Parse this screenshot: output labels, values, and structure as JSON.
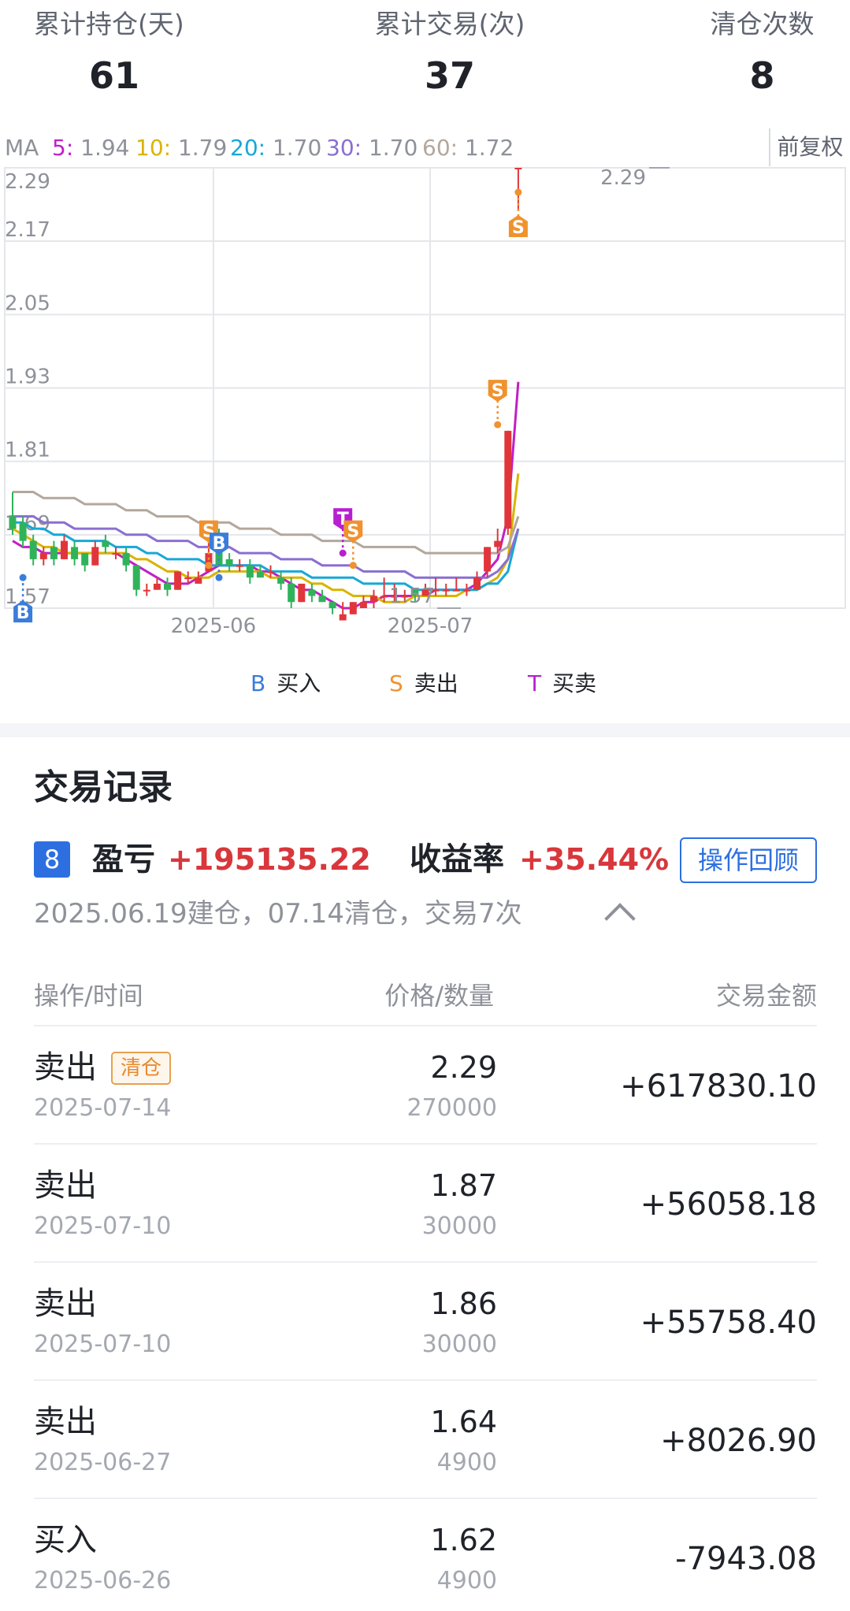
{
  "stats": [
    {
      "label": "累计持仓(天)",
      "value": "61"
    },
    {
      "label": "累计交易(次)",
      "value": "37"
    },
    {
      "label": "清仓次数",
      "value": "8"
    }
  ],
  "ma": {
    "prefix": "MA",
    "items": [
      {
        "key": "5:",
        "value": "1.94",
        "color": "#c21fc6"
      },
      {
        "key": "10:",
        "value": "1.79",
        "color": "#d9b400"
      },
      {
        "key": "20:",
        "value": "1.70",
        "color": "#17a8d6"
      },
      {
        "key": "30:",
        "value": "1.70",
        "color": "#8a6fd0"
      },
      {
        "key": "60:",
        "value": "1.72",
        "color": "#b3a79c"
      }
    ],
    "adjust_label": "前复权"
  },
  "chart_data": {
    "type": "candlestick",
    "y_tick_labels": [
      "2.29",
      "2.17",
      "2.05",
      "1.93",
      "1.81",
      "1.69",
      "1.57"
    ],
    "ylim": [
      1.57,
      2.29
    ],
    "x_tick_labels": [
      "2025-06",
      "2025-07"
    ],
    "max_label": "2.29",
    "min_label": "1.57",
    "up_color": "#e0363b",
    "down_color": "#2fb35a",
    "candles": [
      {
        "o": 1.72,
        "c": 1.7,
        "h": 1.76,
        "l": 1.69
      },
      {
        "o": 1.71,
        "c": 1.68,
        "h": 1.72,
        "l": 1.67
      },
      {
        "o": 1.68,
        "c": 1.65,
        "h": 1.69,
        "l": 1.64
      },
      {
        "o": 1.65,
        "c": 1.66,
        "h": 1.67,
        "l": 1.64
      },
      {
        "o": 1.67,
        "c": 1.65,
        "h": 1.68,
        "l": 1.64
      },
      {
        "o": 1.65,
        "c": 1.68,
        "h": 1.69,
        "l": 1.65
      },
      {
        "o": 1.67,
        "c": 1.65,
        "h": 1.68,
        "l": 1.64
      },
      {
        "o": 1.66,
        "c": 1.64,
        "h": 1.66,
        "l": 1.63
      },
      {
        "o": 1.64,
        "c": 1.67,
        "h": 1.68,
        "l": 1.64
      },
      {
        "o": 1.68,
        "c": 1.67,
        "h": 1.69,
        "l": 1.66
      },
      {
        "o": 1.66,
        "c": 1.66,
        "h": 1.67,
        "l": 1.65
      },
      {
        "o": 1.66,
        "c": 1.64,
        "h": 1.67,
        "l": 1.63
      },
      {
        "o": 1.64,
        "c": 1.6,
        "h": 1.64,
        "l": 1.59
      },
      {
        "o": 1.6,
        "c": 1.6,
        "h": 1.61,
        "l": 1.59
      },
      {
        "o": 1.6,
        "c": 1.61,
        "h": 1.62,
        "l": 1.6
      },
      {
        "o": 1.61,
        "c": 1.6,
        "h": 1.62,
        "l": 1.59
      },
      {
        "o": 1.6,
        "c": 1.63,
        "h": 1.63,
        "l": 1.6
      },
      {
        "o": 1.62,
        "c": 1.62,
        "h": 1.63,
        "l": 1.61
      },
      {
        "o": 1.61,
        "c": 1.62,
        "h": 1.63,
        "l": 1.61
      },
      {
        "o": 1.63,
        "c": 1.66,
        "h": 1.71,
        "l": 1.63
      },
      {
        "o": 1.67,
        "c": 1.64,
        "h": 1.7,
        "l": 1.64
      },
      {
        "o": 1.65,
        "c": 1.64,
        "h": 1.66,
        "l": 1.63
      },
      {
        "o": 1.64,
        "c": 1.64,
        "h": 1.65,
        "l": 1.63
      },
      {
        "o": 1.64,
        "c": 1.62,
        "h": 1.65,
        "l": 1.61
      },
      {
        "o": 1.63,
        "c": 1.62,
        "h": 1.64,
        "l": 1.62
      },
      {
        "o": 1.63,
        "c": 1.63,
        "h": 1.64,
        "l": 1.62
      },
      {
        "o": 1.62,
        "c": 1.61,
        "h": 1.63,
        "l": 1.6
      },
      {
        "o": 1.61,
        "c": 1.58,
        "h": 1.62,
        "l": 1.57
      },
      {
        "o": 1.58,
        "c": 1.61,
        "h": 1.61,
        "l": 1.58
      },
      {
        "o": 1.6,
        "c": 1.59,
        "h": 1.61,
        "l": 1.58
      },
      {
        "o": 1.59,
        "c": 1.58,
        "h": 1.6,
        "l": 1.58
      },
      {
        "o": 1.58,
        "c": 1.57,
        "h": 1.58,
        "l": 1.56
      },
      {
        "o": 1.55,
        "c": 1.56,
        "h": 1.58,
        "l": 1.55
      },
      {
        "o": 1.56,
        "c": 1.58,
        "h": 1.58,
        "l": 1.56
      },
      {
        "o": 1.57,
        "c": 1.58,
        "h": 1.59,
        "l": 1.57
      },
      {
        "o": 1.58,
        "c": 1.59,
        "h": 1.6,
        "l": 1.57
      },
      {
        "o": 1.59,
        "c": 1.59,
        "h": 1.62,
        "l": 1.58
      },
      {
        "o": 1.59,
        "c": 1.59,
        "h": 1.61,
        "l": 1.58
      },
      {
        "o": 1.59,
        "c": 1.59,
        "h": 1.6,
        "l": 1.58
      },
      {
        "o": 1.6,
        "c": 1.59,
        "h": 1.6,
        "l": 1.58
      },
      {
        "o": 1.59,
        "c": 1.6,
        "h": 1.61,
        "l": 1.59
      },
      {
        "o": 1.6,
        "c": 1.6,
        "h": 1.62,
        "l": 1.59
      },
      {
        "o": 1.6,
        "c": 1.6,
        "h": 1.61,
        "l": 1.59
      },
      {
        "o": 1.6,
        "c": 1.6,
        "h": 1.62,
        "l": 1.6
      },
      {
        "o": 1.6,
        "c": 1.6,
        "h": 1.61,
        "l": 1.59
      },
      {
        "o": 1.6,
        "c": 1.62,
        "h": 1.63,
        "l": 1.6
      },
      {
        "o": 1.63,
        "c": 1.67,
        "h": 1.67,
        "l": 1.62
      },
      {
        "o": 1.67,
        "c": 1.68,
        "h": 1.7,
        "l": 1.66
      },
      {
        "o": 1.7,
        "c": 1.86,
        "h": 1.86,
        "l": 1.69
      },
      {
        "o": 2.29,
        "c": 2.29,
        "h": 2.29,
        "l": 2.22
      }
    ],
    "series": [
      {
        "name": "5",
        "color": "#c21fc6",
        "values": [
          1.68,
          1.67,
          1.67,
          1.66,
          1.66,
          1.66,
          1.66,
          1.66,
          1.66,
          1.66,
          1.66,
          1.65,
          1.64,
          1.63,
          1.62,
          1.61,
          1.61,
          1.61,
          1.62,
          1.63,
          1.64,
          1.64,
          1.64,
          1.64,
          1.63,
          1.63,
          1.62,
          1.61,
          1.6,
          1.6,
          1.59,
          1.58,
          1.57,
          1.57,
          1.58,
          1.58,
          1.59,
          1.59,
          1.59,
          1.59,
          1.59,
          1.6,
          1.6,
          1.6,
          1.6,
          1.61,
          1.63,
          1.65,
          1.72,
          1.94
        ]
      },
      {
        "name": "10",
        "color": "#d9b400",
        "values": [
          1.7,
          1.69,
          1.68,
          1.67,
          1.67,
          1.66,
          1.66,
          1.66,
          1.66,
          1.66,
          1.66,
          1.66,
          1.65,
          1.65,
          1.64,
          1.63,
          1.63,
          1.62,
          1.62,
          1.62,
          1.63,
          1.63,
          1.63,
          1.63,
          1.63,
          1.62,
          1.62,
          1.62,
          1.62,
          1.61,
          1.61,
          1.6,
          1.6,
          1.59,
          1.59,
          1.59,
          1.58,
          1.58,
          1.58,
          1.59,
          1.59,
          1.59,
          1.59,
          1.59,
          1.6,
          1.6,
          1.61,
          1.62,
          1.65,
          1.79
        ]
      },
      {
        "name": "20",
        "color": "#17a8d6",
        "values": [
          1.71,
          1.71,
          1.7,
          1.7,
          1.69,
          1.69,
          1.68,
          1.68,
          1.68,
          1.68,
          1.67,
          1.67,
          1.67,
          1.66,
          1.66,
          1.65,
          1.65,
          1.65,
          1.65,
          1.64,
          1.64,
          1.64,
          1.64,
          1.64,
          1.64,
          1.63,
          1.63,
          1.63,
          1.63,
          1.62,
          1.62,
          1.62,
          1.62,
          1.62,
          1.61,
          1.61,
          1.61,
          1.61,
          1.61,
          1.6,
          1.6,
          1.6,
          1.6,
          1.6,
          1.6,
          1.6,
          1.61,
          1.61,
          1.63,
          1.7
        ]
      },
      {
        "name": "30",
        "color": "#8a6fd0",
        "values": [
          1.72,
          1.72,
          1.72,
          1.71,
          1.71,
          1.71,
          1.7,
          1.7,
          1.7,
          1.7,
          1.7,
          1.69,
          1.69,
          1.69,
          1.68,
          1.68,
          1.68,
          1.68,
          1.67,
          1.67,
          1.67,
          1.67,
          1.66,
          1.66,
          1.66,
          1.66,
          1.65,
          1.65,
          1.65,
          1.65,
          1.64,
          1.64,
          1.64,
          1.64,
          1.63,
          1.63,
          1.63,
          1.63,
          1.63,
          1.62,
          1.62,
          1.62,
          1.62,
          1.62,
          1.62,
          1.62,
          1.62,
          1.63,
          1.65,
          1.7
        ]
      },
      {
        "name": "60",
        "color": "#b3a79c",
        "values": [
          1.76,
          1.76,
          1.76,
          1.75,
          1.75,
          1.75,
          1.75,
          1.74,
          1.74,
          1.74,
          1.74,
          1.73,
          1.73,
          1.73,
          1.72,
          1.72,
          1.72,
          1.72,
          1.71,
          1.71,
          1.71,
          1.71,
          1.7,
          1.7,
          1.7,
          1.7,
          1.69,
          1.69,
          1.69,
          1.69,
          1.68,
          1.68,
          1.68,
          1.68,
          1.67,
          1.67,
          1.67,
          1.67,
          1.67,
          1.67,
          1.66,
          1.66,
          1.66,
          1.66,
          1.66,
          1.66,
          1.66,
          1.66,
          1.67,
          1.72
        ]
      }
    ],
    "markers": [
      {
        "type": "B",
        "index": 1,
        "price": 1.62,
        "pos": "below",
        "color": "#3a7ddb"
      },
      {
        "type": "S",
        "index": 19,
        "price": 1.64,
        "pos": "above",
        "color": "#f0922e"
      },
      {
        "type": "B",
        "index": 20,
        "price": 1.62,
        "pos": "above",
        "color": "#3a7ddb"
      },
      {
        "type": "T",
        "index": 32,
        "price": 1.66,
        "pos": "above",
        "color": "#b81fd0"
      },
      {
        "type": "S",
        "index": 33,
        "price": 1.64,
        "pos": "above",
        "color": "#f0922e"
      },
      {
        "type": "S",
        "index": 47,
        "price": 1.87,
        "pos": "above",
        "color": "#f0922e"
      },
      {
        "type": "S",
        "index": 49,
        "price": 2.25,
        "pos": "below",
        "color": "#f0922e"
      }
    ]
  },
  "legend": [
    {
      "key": "B",
      "label": "买入",
      "color": "#3a7ddb"
    },
    {
      "key": "S",
      "label": "卖出",
      "color": "#f0922e"
    },
    {
      "key": "T",
      "label": "买卖",
      "color": "#b81fd0"
    }
  ],
  "records": {
    "title": "交易记录",
    "round_badge": "8",
    "pnl_label": "盈亏",
    "pnl_value": "+195135.22",
    "return_label": "收益率",
    "return_value": "+35.44%",
    "review_button": "操作回顾",
    "subinfo": "2025.06.19建仓，07.14清仓，交易7次",
    "headers": {
      "col1": "操作/时间",
      "col2": "价格/数量",
      "col3": "交易金额"
    },
    "rows": [
      {
        "op": "卖出",
        "tag": "清仓",
        "date": "2025-07-14",
        "price": "2.29",
        "qty": "270000",
        "amount": "+617830.10"
      },
      {
        "op": "卖出",
        "tag": "",
        "date": "2025-07-10",
        "price": "1.87",
        "qty": "30000",
        "amount": "+56058.18"
      },
      {
        "op": "卖出",
        "tag": "",
        "date": "2025-07-10",
        "price": "1.86",
        "qty": "30000",
        "amount": "+55758.40"
      },
      {
        "op": "卖出",
        "tag": "",
        "date": "2025-06-27",
        "price": "1.64",
        "qty": "4900",
        "amount": "+8026.90"
      },
      {
        "op": "买入",
        "tag": "",
        "date": "2025-06-26",
        "price": "1.62",
        "qty": "4900",
        "amount": "-7943.08"
      }
    ]
  }
}
